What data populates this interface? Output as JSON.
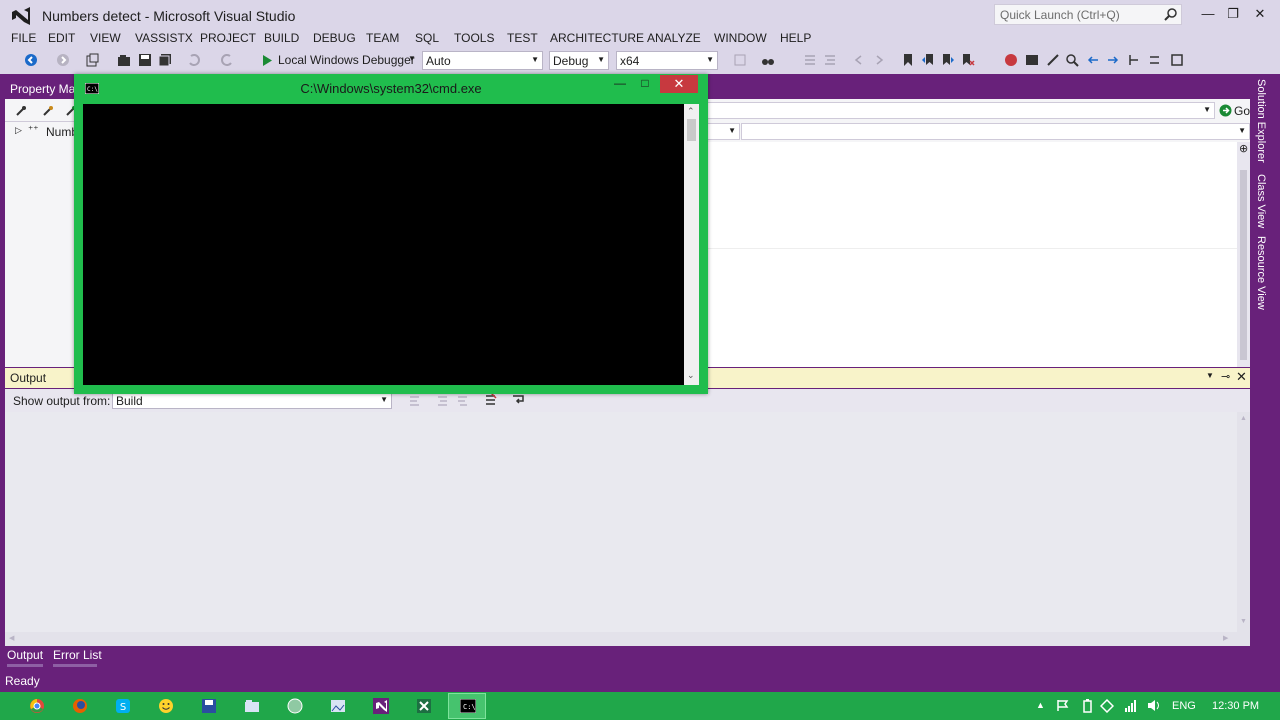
{
  "window": {
    "title": "Numbers detect - Microsoft Visual Studio",
    "quick_launch_placeholder": "Quick Launch (Ctrl+Q)",
    "min": "—",
    "max": "❐",
    "close": "✕"
  },
  "menu": [
    "FILE",
    "EDIT",
    "VIEW",
    "VASSISTX",
    "PROJECT",
    "BUILD",
    "DEBUG",
    "TEAM",
    "SQL",
    "TOOLS",
    "TEST",
    "ARCHITECTURE",
    "ANALYZE",
    "WINDOW",
    "HELP"
  ],
  "toolbar": {
    "debugger_label": "Local Windows Debugger",
    "auto_value": "Auto",
    "config_value": "Debug",
    "platform_value": "x64"
  },
  "left_panel": {
    "title": "Property Man",
    "tree_item": "Numb"
  },
  "main": {
    "go_label": "Go"
  },
  "right_tabs": [
    "Solution Explorer",
    "Class View",
    "Resource View"
  ],
  "output": {
    "title": "Output",
    "show_from_label": "Show output from:",
    "source_value": "Build"
  },
  "bottom_tabs": [
    "Output",
    "Error List"
  ],
  "status": "Ready",
  "cmd": {
    "title": "C:\\Windows\\system32\\cmd.exe",
    "min": "—",
    "max": "□",
    "close": "✕"
  },
  "taskbar": {
    "lang": "ENG",
    "clock": "12:30 PM"
  },
  "colors": {
    "vs_purple": "#68217a",
    "chrome": "#dbd6e8",
    "cmd_frame": "#20bd4d",
    "taskbar": "#20a74a"
  }
}
